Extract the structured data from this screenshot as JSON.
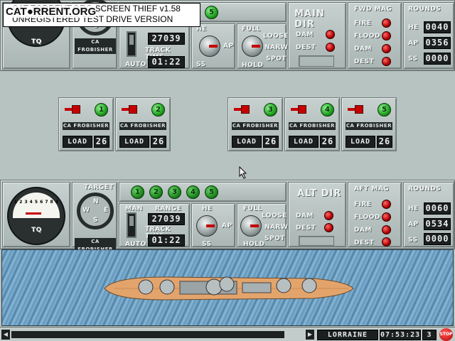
{
  "watermark": {
    "line1": "CAT TORRENT.ORG  SCREEN THIEF v1.58",
    "line2": "UNREGISTERED TEST DRIVE VERSION",
    "logo": "CAT●RRENT.ORG"
  },
  "fwd": {
    "gauge_label": "TQ",
    "ship_name": "CA FROBISHER",
    "mode_label": "AUTO",
    "track_time_label": "TRACK TIME",
    "range_value": "27039",
    "track_time_value": "01:22",
    "he_label": "HE",
    "ap_label": "AP",
    "ss_label": "SS",
    "full_label": "FULL",
    "loose_label": "LOOSE",
    "narw_label": "NARW",
    "spot_label": "SPOT",
    "hold_label": "HOLD",
    "dir_title": "MAIN DIR",
    "dam_label": "DAM",
    "dest_label": "DEST",
    "mag_title": "FWD MAG",
    "mag_items": [
      "FIRE",
      "FLOOD",
      "DAM",
      "DEST"
    ],
    "rounds_title": "ROUNDS",
    "rounds": [
      {
        "label": "HE",
        "value": "0040"
      },
      {
        "label": "AP",
        "value": "0356"
      },
      {
        "label": "SS",
        "value": "0000"
      }
    ],
    "top_button": "5"
  },
  "turrets": [
    {
      "num": "1",
      "ship": "CA FROBISHER",
      "load_label": "LOAD",
      "load_value": "26"
    },
    {
      "num": "2",
      "ship": "CA FROBISHER",
      "load_label": "LOAD",
      "load_value": "26"
    },
    {
      "num": "3",
      "ship": "CA FROBISHER",
      "load_label": "LOAD",
      "load_value": "26"
    },
    {
      "num": "4",
      "ship": "CA FROBISHER",
      "load_label": "LOAD",
      "load_value": "26"
    },
    {
      "num": "5",
      "ship": "CA FROBISHER",
      "load_label": "LOAD",
      "load_value": "26"
    }
  ],
  "aft": {
    "gauge_label": "TQ",
    "dial_ticks": [
      "1",
      "2",
      "3",
      "4",
      "5",
      "6",
      "7",
      "8",
      "9"
    ],
    "target_label": "TARGET",
    "compass": [
      "N",
      "W",
      "E",
      "S"
    ],
    "ship_name": "CA FROBISHER",
    "turret_buttons": [
      "1",
      "2",
      "3",
      "4",
      "5"
    ],
    "man_label": "MAN",
    "auto_label": "AUTO",
    "range_label": "RANGE",
    "range_value": "27039",
    "track_time_label": "TRACK TIME",
    "track_time_value": "01:22",
    "he_label": "HE",
    "ap_label": "AP",
    "ss_label": "SS",
    "full_label": "FULL",
    "loose_label": "LOOSE",
    "narw_label": "NARW",
    "spot_label": "SPOT",
    "hold_label": "HOLD",
    "dir_title": "ALT DIR",
    "dam_label": "DAM",
    "dest_label": "DEST",
    "mag_title": "AFT MAG",
    "mag_items": [
      "FIRE",
      "FLOOD",
      "DAM",
      "DEST"
    ],
    "rounds_title": "ROUNDS",
    "rounds": [
      {
        "label": "HE",
        "value": "0060"
      },
      {
        "label": "AP",
        "value": "0534"
      },
      {
        "label": "SS",
        "value": "0000"
      }
    ]
  },
  "status": {
    "ship": "LORRAINE",
    "clock": "07:53:23",
    "count": "3",
    "stop_label": "STOP"
  },
  "colors": {
    "metal": "#aeb9b7",
    "led_red": "#c40000",
    "button_green": "#1f9f1f",
    "sea": "#6a9cc0",
    "deck": "#e3a46c"
  }
}
